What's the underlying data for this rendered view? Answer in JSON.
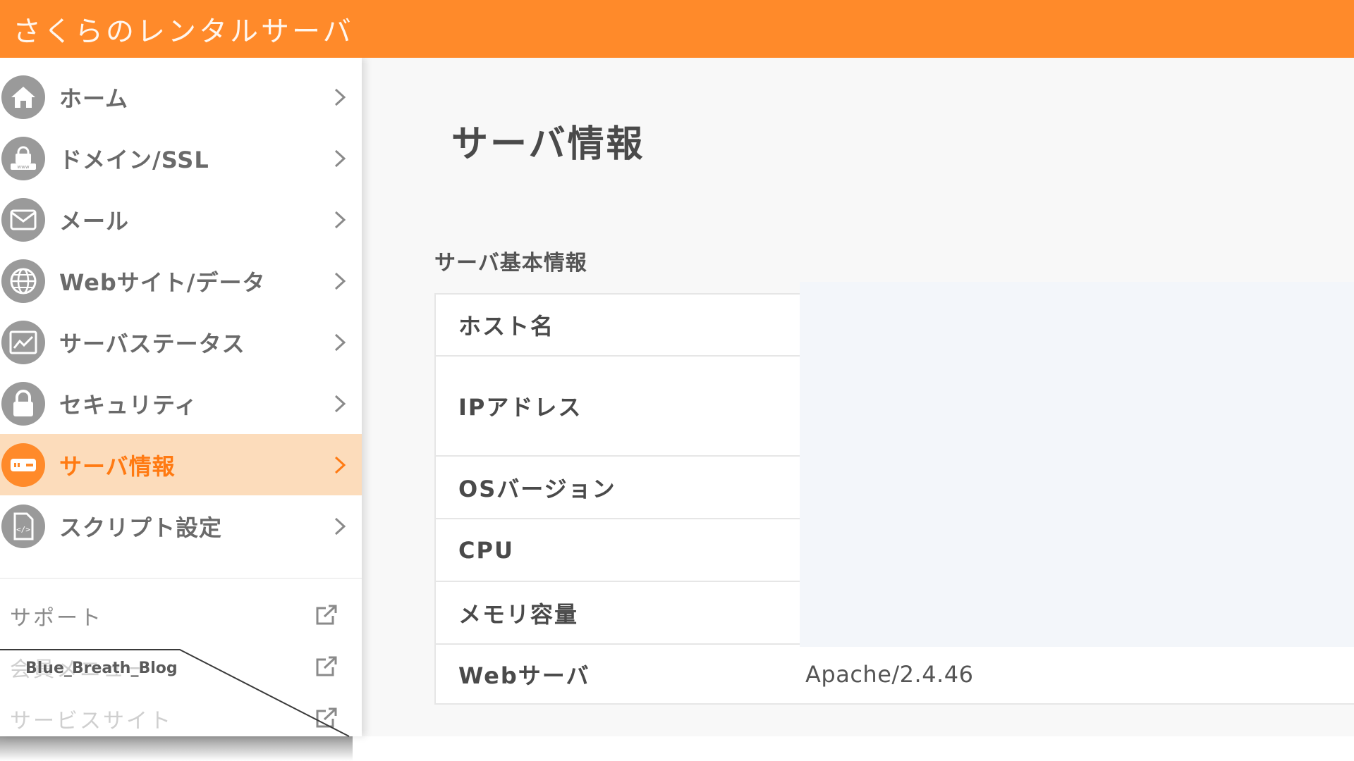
{
  "header": {
    "brand": "さくらのレンタルサーバ"
  },
  "sidebar": {
    "items": [
      {
        "label": "ホーム",
        "icon": "home-icon"
      },
      {
        "label": "ドメイン/SSL",
        "icon": "domain-lock-icon"
      },
      {
        "label": "メール",
        "icon": "mail-icon"
      },
      {
        "label": "Webサイト/データ",
        "icon": "globe-icon"
      },
      {
        "label": "サーバステータス",
        "icon": "chart-icon"
      },
      {
        "label": "セキュリティ",
        "icon": "lock-icon"
      },
      {
        "label": "サーバ情報",
        "icon": "server-icon",
        "active": true
      },
      {
        "label": "スクリプト設定",
        "icon": "script-file-icon"
      }
    ],
    "links": [
      {
        "label": "サポート"
      },
      {
        "label": "会員メニュー"
      },
      {
        "label": "サービスサイト"
      }
    ],
    "watermark": "Blue_Breath_Blog"
  },
  "main": {
    "title": "サーバ情報",
    "section": "サーバ基本情報",
    "rows": [
      {
        "label": "ホスト名",
        "value": ""
      },
      {
        "label": "IPアドレス",
        "value": ""
      },
      {
        "label": "OSバージョン",
        "value": ""
      },
      {
        "label": "CPU",
        "value": ""
      },
      {
        "label": "メモリ容量",
        "value": ""
      },
      {
        "label": "Webサーバ",
        "value": "Apache/2.4.46"
      }
    ]
  },
  "colors": {
    "accent": "#ff8a2a",
    "active_bg": "#fcdcbb",
    "icon_gray": "#9a9a9a"
  }
}
